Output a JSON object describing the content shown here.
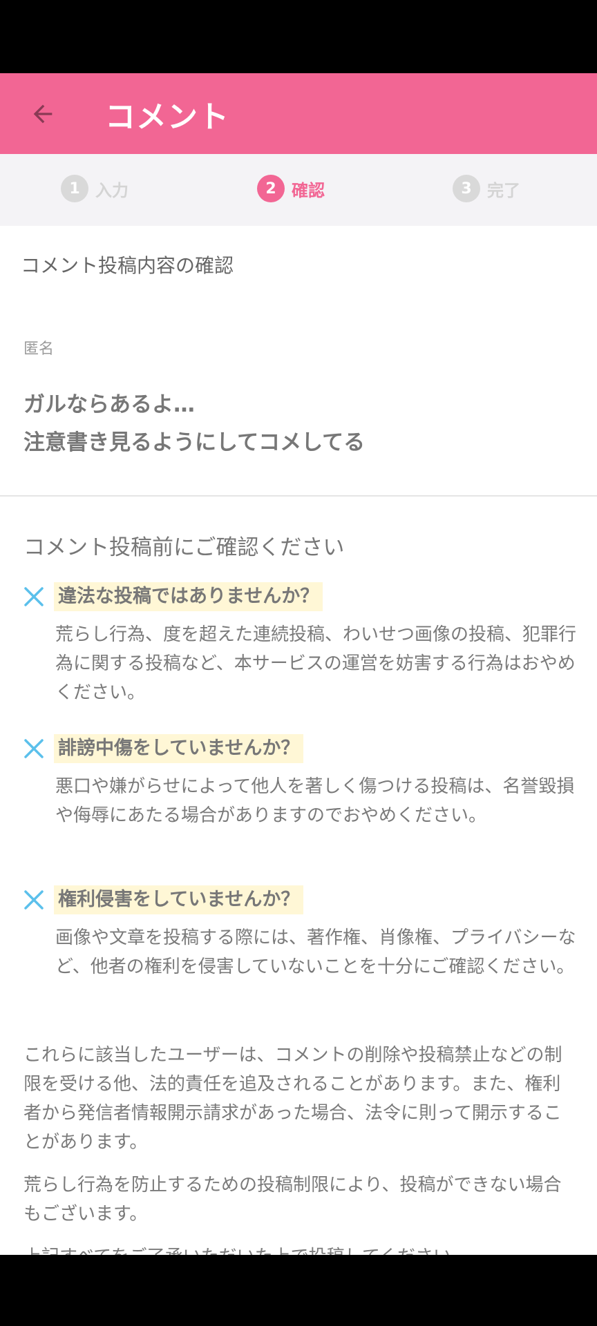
{
  "app_bar": {
    "title": "コメント"
  },
  "stepper": {
    "steps": [
      {
        "number": "1",
        "label": "入力"
      },
      {
        "number": "2",
        "label": "確認"
      },
      {
        "number": "3",
        "label": "完了"
      }
    ]
  },
  "confirm": {
    "section_title": "コメント投稿内容の確認",
    "author": "匿名",
    "comment": "ガルならあるよ…\n注意書き見るようにしてコメしてる"
  },
  "checks": {
    "title": "コメント投稿前にご確認ください",
    "rules": [
      {
        "title": "違法な投稿ではありませんか？",
        "text": "荒らし行為、度を超えた連続投稿、わいせつ画像の投稿、犯罪行為に関する投稿など、本サービスの運営を妨害する行為はおやめください。"
      },
      {
        "title": "誹謗中傷をしていませんか？",
        "text": "悪口や嫌がらせによって他人を著しく傷つける投稿は、名誉毀損や侮辱にあたる場合がありますのでおやめください。"
      },
      {
        "title": "権利侵害をしていませんか？",
        "text": "画像や文章を投稿する際には、著作権、肖像権、プライバシーなど、他者の権利を侵害していないことを十分にご確認ください。"
      }
    ],
    "note1": "これらに該当したユーザーは、コメントの削除や投稿禁止などの制限を受ける他、法的責任を追及されることがあります。また、権利者から発信者情報開示請求があった場合、法令に則って開示することがあります。",
    "note2": "荒らし行為を防止するための投稿制限により、投稿ができない場合もございます。",
    "note3": "上記すべてをご了承いただいた上で投稿してください。"
  },
  "colors": {
    "accent": "#f26694",
    "highlight": "#fff7d6",
    "x_icon": "#5bc0eb"
  }
}
